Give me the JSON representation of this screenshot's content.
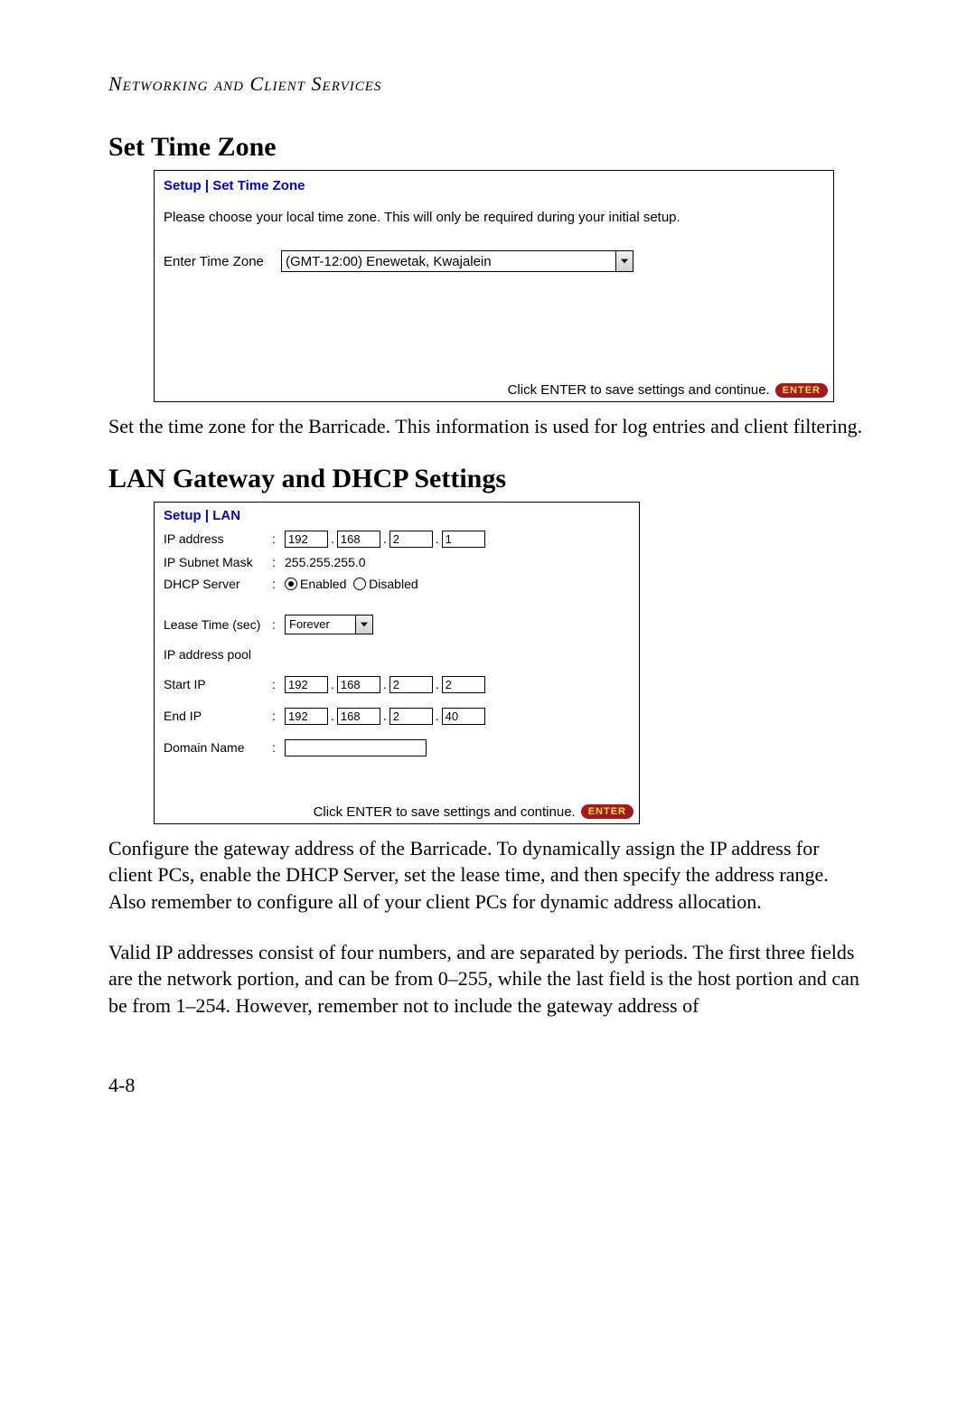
{
  "header": "Networking and Client Services",
  "section1": {
    "title": "Set Time Zone",
    "breadcrumb": "Setup | Set Time Zone",
    "instruction": "Please choose your local time zone. This will only be required during your initial setup.",
    "tz_label": "Enter Time Zone",
    "tz_value": "(GMT-12:00) Enewetak, Kwajalein",
    "footer_text": "Click ENTER to save settings and continue.",
    "enter_label": "ENTER",
    "body": "Set the time zone for the Barricade. This information is used for log entries and client filtering."
  },
  "section2": {
    "title": "LAN Gateway and DHCP Settings",
    "breadcrumb": "Setup | LAN",
    "ip_label": "IP address",
    "ip_parts": [
      "192",
      "168",
      "2",
      "1"
    ],
    "subnet_label": "IP Subnet Mask",
    "subnet_value": "255.255.255.0",
    "dhcp_label": "DHCP Server",
    "dhcp_enabled_label": "Enabled",
    "dhcp_disabled_label": "Disabled",
    "dhcp_selected": "enabled",
    "lease_label": "Lease Time (sec)",
    "lease_value": "Forever",
    "pool_label": "IP address pool",
    "start_label": "Start IP",
    "start_parts": [
      "192",
      "168",
      "2",
      "2"
    ],
    "end_label": "End IP",
    "end_parts": [
      "192",
      "168",
      "2",
      "40"
    ],
    "domain_label": "Domain Name",
    "domain_value": "",
    "footer_text": "Click ENTER to save settings and continue.",
    "enter_label": "ENTER",
    "body1": "Configure the gateway address of the Barricade. To dynamically assign the IP address for client PCs, enable the DHCP Server, set the lease time, and then specify the address range. Also remember to configure all of your client PCs for dynamic address allocation.",
    "body2": "Valid IP addresses consist of four numbers, and are separated by periods. The first three fields are the network portion, and can be from 0–255, while the last field is the host portion and can be from 1–254. However, remember not to include the gateway address of"
  },
  "page_number": "4-8"
}
